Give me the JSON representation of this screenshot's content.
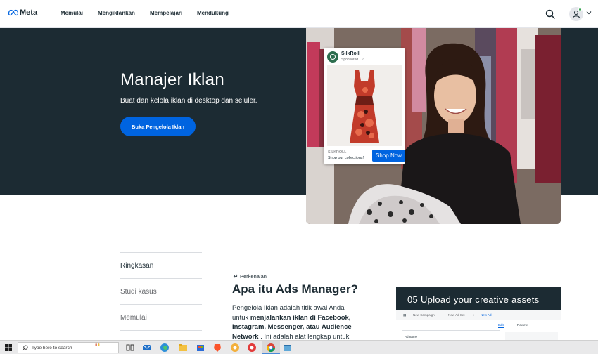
{
  "nav": {
    "logo_text": "Meta",
    "links": [
      "Memulai",
      "Mengiklankan",
      "Mempelajari",
      "Mendukung"
    ]
  },
  "hero": {
    "title": "Manajer Iklan",
    "subtitle": "Buat dan kelola iklan di desktop dan seluler.",
    "cta": "Buka Pengelola Iklan"
  },
  "ad_card": {
    "brand": "SilkRoll",
    "sponsored": "Sponsored · ⊙",
    "domain": "SILKROLL",
    "caption": "Shop our collections!",
    "button": "Shop Now"
  },
  "sidenav": {
    "items": [
      "Ringkasan",
      "Studi kasus",
      "Memulai"
    ]
  },
  "intro": {
    "tag": "Perkenalan",
    "title": "Apa itu Ads Manager?",
    "body_1": "Pengelola Iklan adalah titik awal Anda untuk ",
    "body_bold": "menjalankan iklan di Facebook, Instagram, Messenger, atau Audience Network",
    "body_2": " . Ini adalah alat lengkap untuk"
  },
  "video": {
    "title": "05 Upload your creative assets",
    "crumbs": [
      "New Campaign",
      "New Ad Set",
      "New Ad"
    ],
    "tabs": [
      "Edit",
      "Review"
    ],
    "field_label": "Ad name"
  },
  "taskbar": {
    "search_placeholder": "Type here to search"
  },
  "colors": {
    "hero_bg": "#1c2b33",
    "primary_blue": "#0064e0",
    "status_green": "#31a24c"
  }
}
